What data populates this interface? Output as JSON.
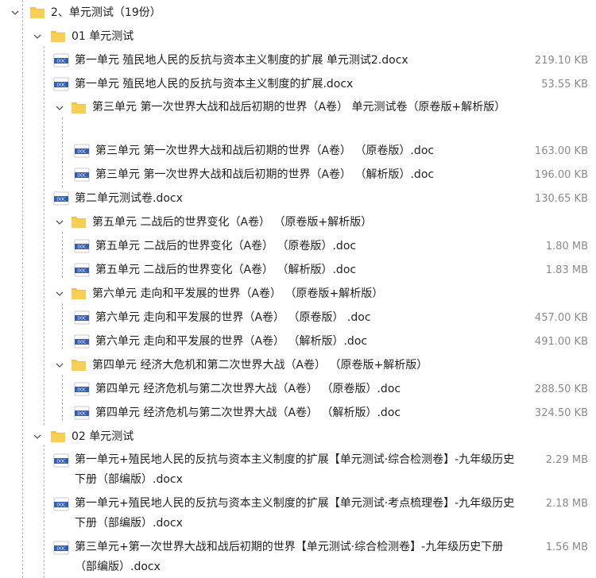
{
  "rows": [
    {
      "type": "folder",
      "label": "2、单元测试（19份）"
    },
    {
      "type": "folder",
      "label": "01 单元测试"
    },
    {
      "type": "file",
      "label": "第一单元 殖民地人民的反抗与资本主义制度的扩展 单元测试2.docx",
      "size": "219.10 KB"
    },
    {
      "type": "file",
      "label": "第一单元 殖民地人民的反抗与资本主义制度的扩展.docx",
      "size": "53.55 KB"
    },
    {
      "type": "folder",
      "label": "第三单元 第一次世界大战和战后初期的世界（A卷） 单元测试卷（原卷版+解析版）"
    },
    {
      "type": "file",
      "label": "第三单元 第一次世界大战和战后初期的世界（A卷） （原卷版）.doc",
      "size": "163.00 KB"
    },
    {
      "type": "file",
      "label": "第三单元 第一次世界大战和战后初期的世界（A卷） （解析版）.doc",
      "size": "196.00 KB"
    },
    {
      "type": "file",
      "label": "第二单元测试卷.docx",
      "size": "130.65 KB"
    },
    {
      "type": "folder",
      "label": "第五单元 二战后的世界变化（A卷） （原卷版+解析版）"
    },
    {
      "type": "file",
      "label": "第五单元 二战后的世界变化（A卷） （原卷版）.doc",
      "size": "1.80 MB"
    },
    {
      "type": "file",
      "label": "第五单元 二战后的世界变化（A卷） （解析版）.doc",
      "size": "1.83 MB"
    },
    {
      "type": "folder",
      "label": "第六单元 走向和平发展的世界（A卷） （原卷版+解析版）"
    },
    {
      "type": "file",
      "label": "第六单元 走向和平发展的世界（A卷） （原卷版） .doc",
      "size": "457.00 KB"
    },
    {
      "type": "file",
      "label": "第六单元 走向和平发展的世界（A卷） （解析版）.doc",
      "size": "491.00 KB"
    },
    {
      "type": "folder",
      "label": "第四单元 经济大危机和第二次世界大战（A卷） （原卷版+解析版）"
    },
    {
      "type": "file",
      "label": "第四单元 经济危机与第二次世界大战（A卷） （原卷版）.doc",
      "size": "288.50 KB"
    },
    {
      "type": "file",
      "label": "第四单元 经济危机与第二次世界大战（A卷） （解析版）.doc",
      "size": "324.50 KB"
    },
    {
      "type": "folder",
      "label": "02 单元测试"
    },
    {
      "type": "file",
      "label": "第一单元+殖民地人民的反抗与资本主义制度的扩展【单元测试·综合检测卷】-九年级历史下册（部编版）.docx",
      "size": "2.29 MB"
    },
    {
      "type": "file",
      "label": "第一单元+殖民地人民的反抗与资本主义制度的扩展【单元测试·考点梳理卷】-九年级历史下册（部编版）.docx",
      "size": "2.18 MB"
    },
    {
      "type": "file",
      "label": "第三单元+第一次世界大战和战后初期的世界【单元测试·综合检测卷】-九年级历史下册（部编版）.docx",
      "size": "1.56 MB"
    }
  ],
  "colors": {
    "folder": "#f5c43c",
    "folder_dark": "#e0a928",
    "doc_blue": "#2f5fb3",
    "text": "#1f1f1f",
    "size": "#8a8a8a",
    "guide": "#b7b7b7"
  }
}
